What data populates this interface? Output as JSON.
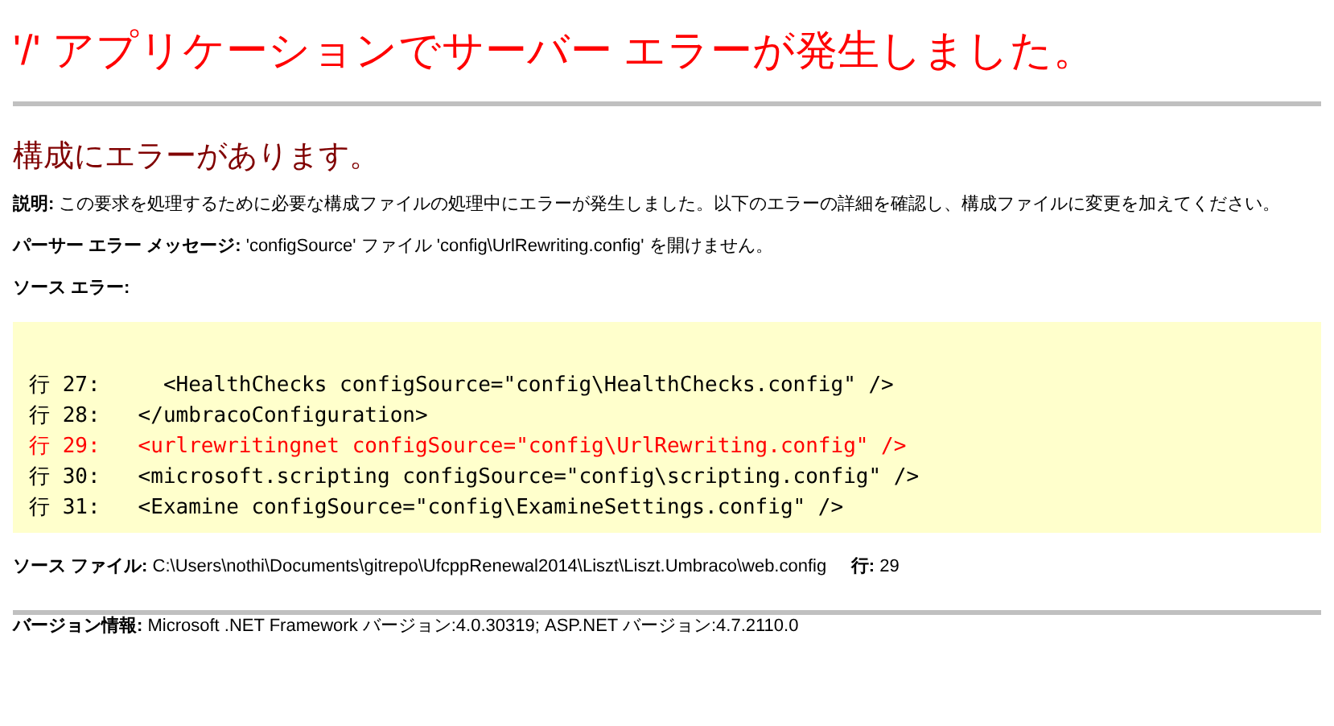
{
  "title": "'/' アプリケーションでサーバー エラーが発生しました。",
  "subtitle": "構成にエラーがあります。",
  "description": "**説明:** この要求を処理するために必要な構成ファイルの処理中にエラーが発生しました。以下のエラーの詳細を確認し、構成ファイルに変更を加えてください。",
  "parser_message": "**パーサー エラー メッセージ:** 'configSource' ファイル 'config\\UrlRewriting.config' を開けません。",
  "source_error_label": "ソース エラー:",
  "code_lines": [
    {
      "text": "行 27:     <HealthChecks configSource=\"config\\HealthChecks.config\" />",
      "highlighted": false
    },
    {
      "text": "行 28:   </umbracoConfiguration>",
      "highlighted": false
    },
    {
      "text": "行 29:   <urlrewritingnet configSource=\"config\\UrlRewriting.config\" />",
      "highlighted": true
    },
    {
      "text": "行 30:   <microsoft.scripting configSource=\"config\\scripting.config\" />",
      "highlighted": false
    },
    {
      "text": "行 31:   <Examine configSource=\"config\\ExamineSettings.config\" />",
      "highlighted": false
    }
  ],
  "source_file": "**ソース ファイル:** C:\\Users\\nothi\\Documents\\gitrepo\\UfcppRenewal2014\\Liszt\\Liszt.Umbraco\\web.config     **行:** 29",
  "version_info": "**バージョン情報:** Microsoft .NET Framework バージョン:4.0.30319; ASP.NET バージョン:4.7.2110.0"
}
